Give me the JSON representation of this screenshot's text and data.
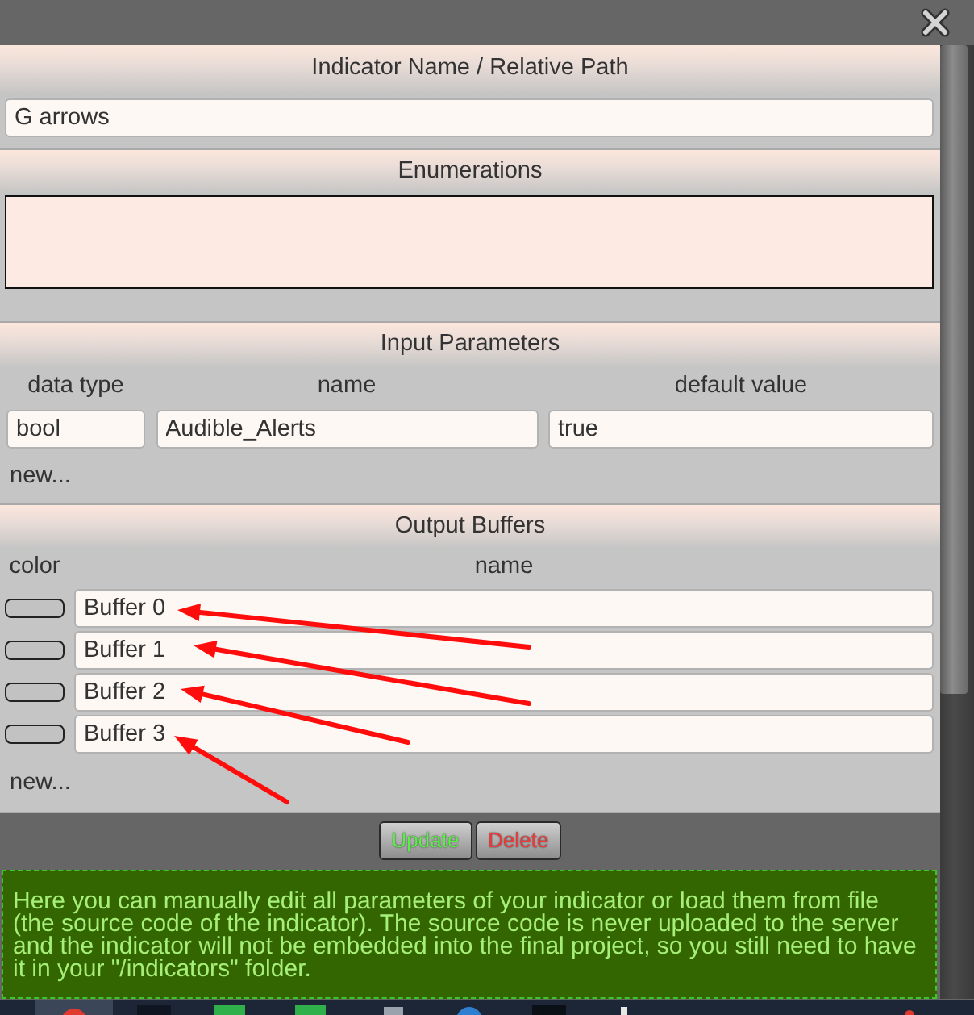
{
  "indicator_name": {
    "title": "Indicator Name / Relative Path",
    "value": "G arrows"
  },
  "enumerations": {
    "title": "Enumerations"
  },
  "input_parameters": {
    "title": "Input Parameters",
    "columns": [
      "data type",
      "name",
      "default value"
    ],
    "rows": [
      {
        "data_type": "bool",
        "name": "Audible_Alerts",
        "default_value": "true"
      }
    ],
    "new_link": "new..."
  },
  "output_buffers": {
    "title": "Output Buffers",
    "columns": [
      "color",
      "name"
    ],
    "rows": [
      {
        "name": "Buffer 0",
        "annotated": true
      },
      {
        "name": "Buffer 1",
        "annotated": true
      },
      {
        "name": "Buffer 2",
        "annotated": true
      },
      {
        "name": "Buffer 3",
        "annotated": true
      }
    ],
    "new_link": "new..."
  },
  "buttons": [
    {
      "label": "Update",
      "kind": "update"
    },
    {
      "label": "Delete",
      "kind": "delete"
    }
  ],
  "help_text": "Here you can manually edit all parameters of your indicator or load them from file (the source code of the indicator). The source code is never uploaded to the server and the indicator will not be embedded into the final project, so you still need to have it in your \"/indicators\" folder."
}
